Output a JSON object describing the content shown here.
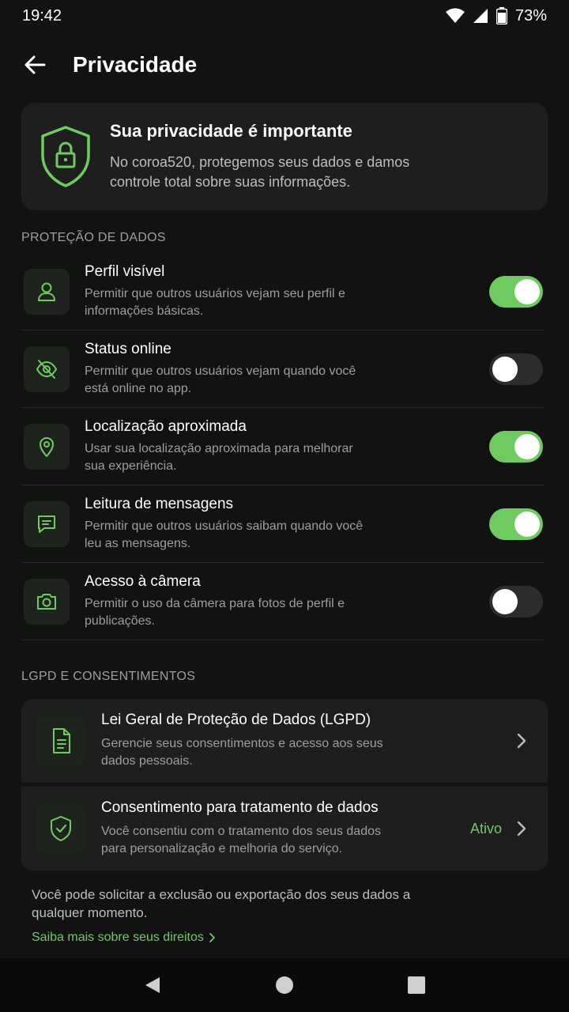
{
  "status_bar": {
    "time": "19:42",
    "battery": "73%"
  },
  "app_bar": {
    "title": "Privacidade"
  },
  "hero": {
    "title": "Sua privacidade é importante",
    "description": "No coroa520, protegemos seus dados e damos controle total sobre suas informações."
  },
  "sections": {
    "data_protection": "PROTEÇÃO DE DADOS",
    "lgpd": "LGPD E CONSENTIMENTOS"
  },
  "settings": [
    {
      "title": "Perfil visível",
      "description": "Permitir que outros usuários vejam seu perfil e informações básicas.",
      "icon": "user-icon",
      "enabled": true
    },
    {
      "title": "Status online",
      "description": "Permitir que outros usuários vejam quando você está online no app.",
      "icon": "eye-off-icon",
      "enabled": false
    },
    {
      "title": "Localização aproximada",
      "description": "Usar sua localização aproximada para melhorar sua experiência.",
      "icon": "location-pin-icon",
      "enabled": true
    },
    {
      "title": "Leitura de mensagens",
      "description": "Permitir que outros usuários saibam quando você leu as mensagens.",
      "icon": "message-icon",
      "enabled": true
    },
    {
      "title": "Acesso à câmera",
      "description": "Permitir o uso da câmera para fotos de perfil e publicações.",
      "icon": "camera-icon",
      "enabled": false
    }
  ],
  "lgpd_cards": [
    {
      "title": "Lei Geral de Proteção de Dados (LGPD)",
      "description": "Gerencie seus consentimentos e acesso aos seus dados pessoais.",
      "icon": "document-icon"
    },
    {
      "title": "Consentimento para tratamento de dados",
      "description": "Você consentiu com o tratamento dos seus dados para personalização e melhoria do serviço.",
      "icon": "shield-check-icon",
      "badge": "Ativo"
    }
  ],
  "footer": {
    "note": "Você pode solicitar a exclusão ou exportação dos seus dados a qualquer momento.",
    "link": "Saiba mais sobre seus direitos"
  },
  "colors": {
    "accent": "#6FCB5F",
    "background": "#121212",
    "card": "#1E1E1E"
  }
}
